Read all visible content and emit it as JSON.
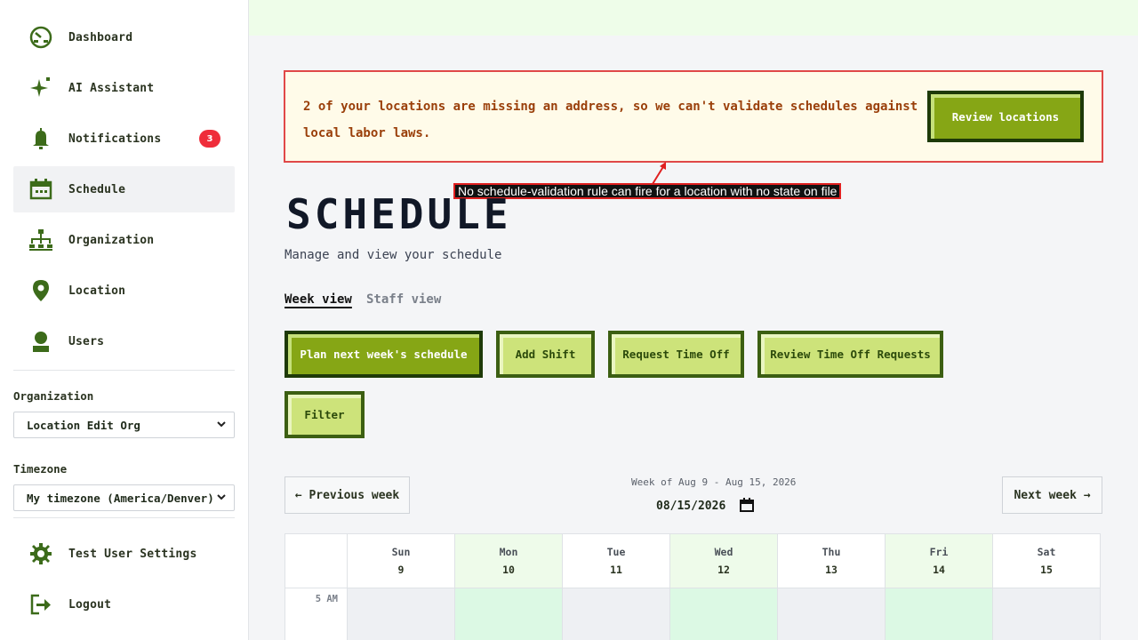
{
  "sidebar": {
    "nav": [
      {
        "label": "Dashboard",
        "icon": "dashboard-icon"
      },
      {
        "label": "AI Assistant",
        "icon": "sparkle-icon"
      },
      {
        "label": "Notifications",
        "icon": "bell-icon",
        "badge": "3"
      },
      {
        "label": "Schedule",
        "icon": "calendar-icon"
      },
      {
        "label": "Organization",
        "icon": "org-chart-icon"
      },
      {
        "label": "Location",
        "icon": "map-pin-icon"
      },
      {
        "label": "Users",
        "icon": "user-icon"
      }
    ],
    "organization_label": "Organization",
    "organization_value": "Location Edit Org",
    "timezone_label": "Timezone",
    "timezone_value": "My timezone (America/Denver)",
    "settings_label": "Test User Settings",
    "logout_label": "Logout"
  },
  "alert": {
    "message": "2 of your locations are missing an address, so we can't validate schedules against local labor laws.",
    "button": "Review locations"
  },
  "tooltip": "No schedule-validation rule can fire for a location with no state on file",
  "page": {
    "title": "SCHEDULE",
    "subtitle": "Manage and view your schedule",
    "tabs": [
      "Week view",
      "Staff view"
    ]
  },
  "actions": {
    "plan": "Plan next week's schedule",
    "add_shift": "Add Shift",
    "request_time_off": "Request Time Off",
    "review_time_off": "Review Time Off Requests",
    "filter": "Filter"
  },
  "week": {
    "prev": "← Previous week",
    "next": "Next week →",
    "label": "Week of Aug 9 - Aug 15, 2026",
    "date_value": "08/15/2026"
  },
  "calendar": {
    "days": [
      {
        "name": "Sun",
        "date": "9"
      },
      {
        "name": "Mon",
        "date": "10"
      },
      {
        "name": "Tue",
        "date": "11"
      },
      {
        "name": "Wed",
        "date": "12"
      },
      {
        "name": "Thu",
        "date": "13"
      },
      {
        "name": "Fri",
        "date": "14"
      },
      {
        "name": "Sat",
        "date": "15"
      }
    ],
    "first_hour": "5 AM"
  },
  "colors": {
    "accent_dark": "#86a615",
    "accent_light": "#cde37a",
    "alert_border": "#e04848",
    "badge": "#ef2d3a",
    "highlight_day": "#eefbea"
  }
}
